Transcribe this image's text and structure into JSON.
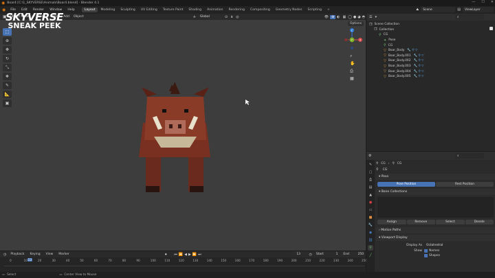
{
  "window": {
    "title": "Boar4 [C:\\1_SKYVERSE\\Animals\\Boar4.blend] - Blender 4.1",
    "min": "—",
    "max": "☐",
    "close": "✕"
  },
  "menu": [
    "File",
    "Edit",
    "Render",
    "Window",
    "Help"
  ],
  "workspaces": [
    "Layout",
    "Modeling",
    "Sculpting",
    "UV Editing",
    "Texture Paint",
    "Shading",
    "Animation",
    "Rendering",
    "Compositing",
    "Geometry Nodes",
    "Scripting"
  ],
  "add_tab": "+",
  "scene": "Scene",
  "view_layer": "ViewLayer",
  "viewport_header": {
    "mode": "Object Mode",
    "menus": [
      "View",
      "Select",
      "Add",
      "Object"
    ],
    "orientation": "Global",
    "options": "Options"
  },
  "logo": {
    "line1": "SKYVERSE",
    "line2": "SNEAK PEEK"
  },
  "outliner": {
    "search_placeholder": "",
    "rows": [
      {
        "label": "Scene Collection",
        "indent": 0,
        "icon": "❐"
      },
      {
        "label": "Collection",
        "indent": 1,
        "icon": "❐"
      },
      {
        "label": "CG",
        "indent": 2,
        "icon": "⚲"
      },
      {
        "label": "Pose",
        "indent": 3,
        "icon": "✦"
      },
      {
        "label": "CG",
        "indent": 3,
        "icon": "⚲"
      },
      {
        "label": "Boar_Body",
        "indent": 3,
        "icon": "▽"
      },
      {
        "label": "Boar_Body.001",
        "indent": 3,
        "icon": "▽"
      },
      {
        "label": "Boar_Body.002",
        "indent": 3,
        "icon": "▽"
      },
      {
        "label": "Boar_Body.003",
        "indent": 3,
        "icon": "▽"
      },
      {
        "label": "Boar_Body.004",
        "indent": 3,
        "icon": "▽"
      },
      {
        "label": "Boar_Body.005",
        "indent": 3,
        "icon": "▽"
      }
    ]
  },
  "properties": {
    "breadcrumb": [
      "CG",
      "CG"
    ],
    "name": "CG",
    "pose_panel": "Pose",
    "pose_position": "Pose Position",
    "rest_position": "Rest Position",
    "bone_collections": "Bone Collections",
    "assign": "Assign",
    "remove": "Remove",
    "select": "Select",
    "deselect": "Desele",
    "motion_paths": "Motion Paths",
    "viewport_display": "Viewport Display",
    "display_as_label": "Display As",
    "display_as_value": "Octahedral",
    "show_label": "Show",
    "names": "Names",
    "shapes": "Shapes"
  },
  "timeline": {
    "menus": [
      "Playback",
      "Keying",
      "View",
      "Marker"
    ],
    "current_frame": "13",
    "start_label": "Start",
    "start": "1",
    "end_label": "End",
    "end": "250",
    "ticks": [
      "0",
      "10",
      "20",
      "30",
      "40",
      "50",
      "60",
      "70",
      "80",
      "90",
      "100",
      "110",
      "120",
      "130",
      "140",
      "150",
      "160",
      "170",
      "180",
      "190",
      "200",
      "210",
      "220",
      "230",
      "240",
      "250"
    ],
    "playhead": "13"
  },
  "status": {
    "left": "Select",
    "mid": "Center View to Mouse"
  },
  "gizmo": {
    "x": "X",
    "y": "Y",
    "z": "Z"
  }
}
